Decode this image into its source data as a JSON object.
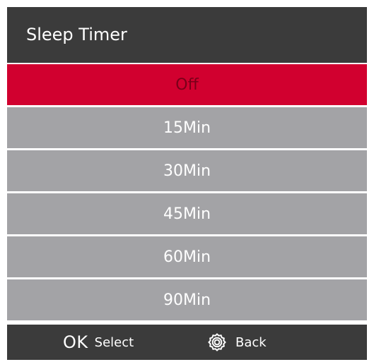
{
  "header": {
    "title": "Sleep Timer"
  },
  "menu": {
    "items": [
      {
        "label": "Off",
        "selected": true
      },
      {
        "label": "15Min",
        "selected": false
      },
      {
        "label": "30Min",
        "selected": false
      },
      {
        "label": "45Min",
        "selected": false
      },
      {
        "label": "60Min",
        "selected": false
      },
      {
        "label": "90Min",
        "selected": false
      }
    ]
  },
  "footer": {
    "ok_key": "OK",
    "ok_label": "Select",
    "back_icon": "gear-icon",
    "back_label": "Back"
  },
  "colors": {
    "header_bg": "#3b3b3b",
    "item_bg": "#a3a3a6",
    "selected_bg": "#d1002f",
    "selected_text": "#7a0019",
    "text": "#ffffff"
  }
}
